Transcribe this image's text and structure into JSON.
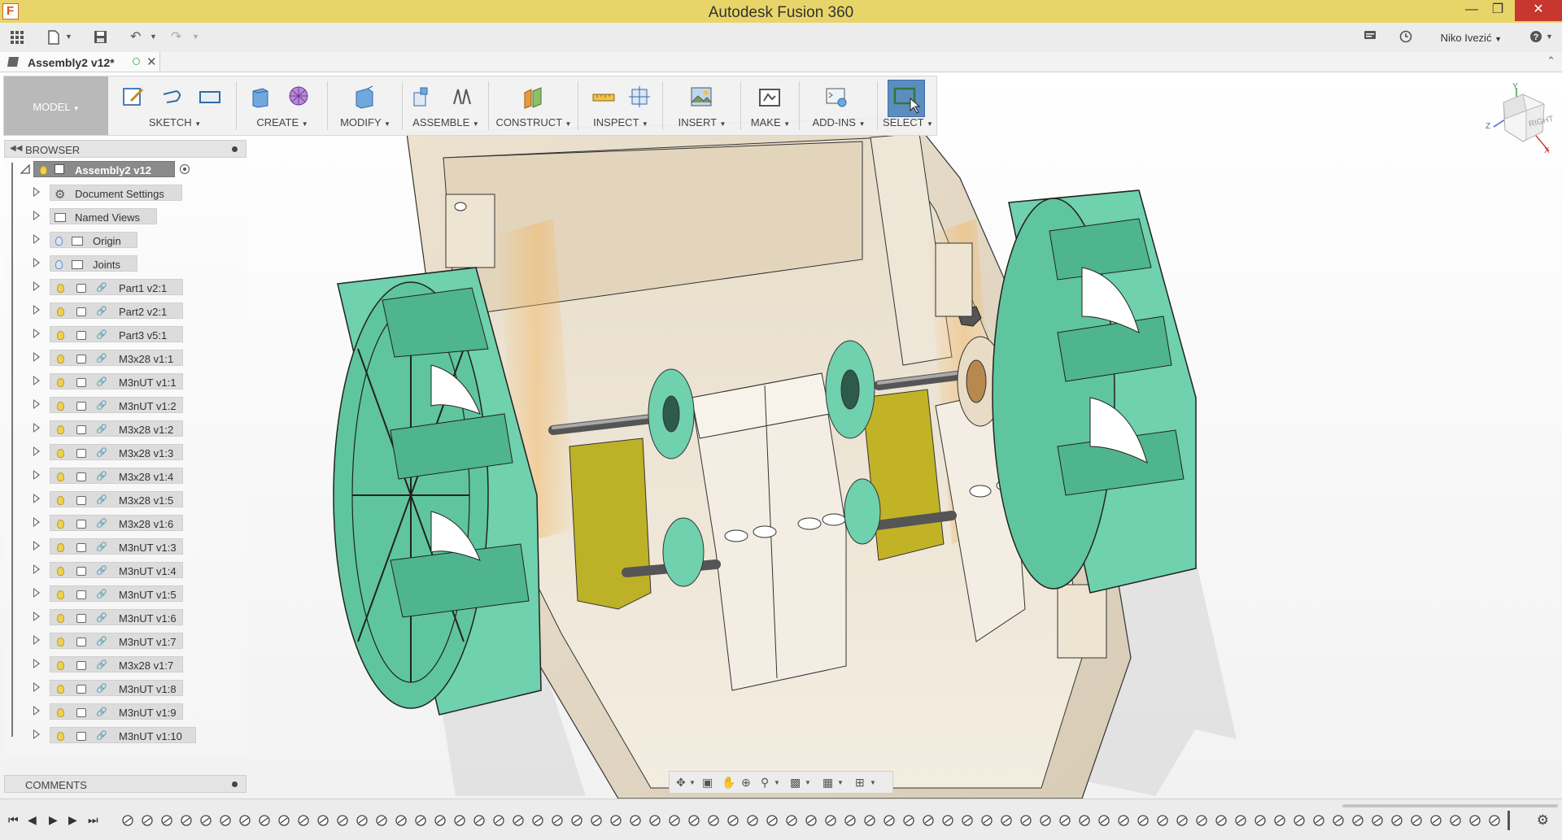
{
  "window": {
    "title": "Autodesk Fusion 360"
  },
  "quickbar": {
    "user_name": "Niko Ivezić"
  },
  "document": {
    "tab_title": "Assembly2 v12*"
  },
  "toolbar": {
    "workspace": "MODEL",
    "groups": [
      {
        "label": "SKETCH"
      },
      {
        "label": "CREATE"
      },
      {
        "label": "MODIFY"
      },
      {
        "label": "ASSEMBLE"
      },
      {
        "label": "CONSTRUCT"
      },
      {
        "label": "INSPECT"
      },
      {
        "label": "INSERT"
      },
      {
        "label": "MAKE"
      },
      {
        "label": "ADD-INS"
      },
      {
        "label": "SELECT"
      }
    ]
  },
  "browser": {
    "title": "BROWSER",
    "root": "Assembly2 v12",
    "items": [
      {
        "label": "Document Settings",
        "kind": "settings"
      },
      {
        "label": "Named Views",
        "kind": "folder"
      },
      {
        "label": "Origin",
        "kind": "folder-bulb"
      },
      {
        "label": "Joints",
        "kind": "folder-bulb"
      },
      {
        "label": "Part1 v2:1",
        "kind": "component"
      },
      {
        "label": "Part2 v2:1",
        "kind": "component"
      },
      {
        "label": "Part3 v5:1",
        "kind": "component"
      },
      {
        "label": "M3x28 v1:1",
        "kind": "component"
      },
      {
        "label": "M3nUT v1:1",
        "kind": "component"
      },
      {
        "label": "M3nUT v1:2",
        "kind": "component"
      },
      {
        "label": "M3x28 v1:2",
        "kind": "component"
      },
      {
        "label": "M3x28 v1:3",
        "kind": "component"
      },
      {
        "label": "M3x28 v1:4",
        "kind": "component"
      },
      {
        "label": "M3x28 v1:5",
        "kind": "component"
      },
      {
        "label": "M3x28 v1:6",
        "kind": "component"
      },
      {
        "label": "M3nUT v1:3",
        "kind": "component"
      },
      {
        "label": "M3nUT v1:4",
        "kind": "component"
      },
      {
        "label": "M3nUT v1:5",
        "kind": "component"
      },
      {
        "label": "M3nUT v1:6",
        "kind": "component"
      },
      {
        "label": "M3nUT v1:7",
        "kind": "component"
      },
      {
        "label": "M3x28 v1:7",
        "kind": "component"
      },
      {
        "label": "M3nUT v1:8",
        "kind": "component"
      },
      {
        "label": "M3nUT v1:9",
        "kind": "component"
      },
      {
        "label": "M3nUT v1:10",
        "kind": "component"
      }
    ]
  },
  "comments": {
    "title": "COMMENTS"
  },
  "viewcube": {
    "face": "RIGHT",
    "axis_y": "Y",
    "axis_z": "Z",
    "axis_x": "X"
  },
  "colors": {
    "title_bar": "#e8d56a",
    "wheel": "#6fd1ad",
    "body": "#efe6d6",
    "motor": "#c2b326",
    "select_active": "#5d8dc0"
  }
}
